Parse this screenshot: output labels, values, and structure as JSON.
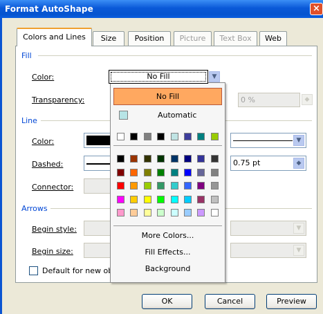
{
  "window": {
    "title": "Format AutoShape",
    "close": "×"
  },
  "tabs": [
    "Colors and Lines",
    "Size",
    "Position",
    "Picture",
    "Text Box",
    "Web"
  ],
  "fill": {
    "group": "Fill",
    "color_label": "Color:",
    "color_value": "No Fill",
    "transparency_label": "Transparency:",
    "transparency_value": "0 %"
  },
  "line": {
    "group": "Line",
    "color_label": "Color:",
    "dashed_label": "Dashed:",
    "connector_label": "Connector:",
    "weight_value": "0.75 pt"
  },
  "arrows": {
    "group": "Arrows",
    "begin_style_label": "Begin style:",
    "begin_size_label": "Begin size:"
  },
  "default_checkbox_label": "Default for new ob",
  "color_menu": {
    "no_fill": "No Fill",
    "automatic": "Automatic",
    "automatic_swatch": "#b7e4e6",
    "recent_colors": [
      "#ffffff",
      "#000000",
      "#808080",
      "#000000",
      "#c0e4e4",
      "#3d3d9c",
      "#008080",
      "#99cc00"
    ],
    "palette": [
      [
        "#000000",
        "#993300",
        "#333300",
        "#003300",
        "#003366",
        "#000080",
        "#333399",
        "#333333"
      ],
      [
        "#800000",
        "#ff6600",
        "#808000",
        "#008000",
        "#008080",
        "#0000ff",
        "#666699",
        "#808080"
      ],
      [
        "#ff0000",
        "#ff9900",
        "#99cc00",
        "#339966",
        "#33cccc",
        "#3366ff",
        "#800080",
        "#969696"
      ],
      [
        "#ff00ff",
        "#ffcc00",
        "#ffff00",
        "#00ff00",
        "#00ffff",
        "#00ccff",
        "#993366",
        "#c0c0c0"
      ],
      [
        "#ff99cc",
        "#ffcc99",
        "#ffff99",
        "#ccffcc",
        "#ccffff",
        "#99ccff",
        "#cc99ff",
        "#ffffff"
      ]
    ],
    "more_colors": "More Colors...",
    "fill_effects": "Fill Effects...",
    "background": "Background"
  },
  "buttons": {
    "ok": "OK",
    "cancel": "Cancel",
    "preview": "Preview"
  }
}
